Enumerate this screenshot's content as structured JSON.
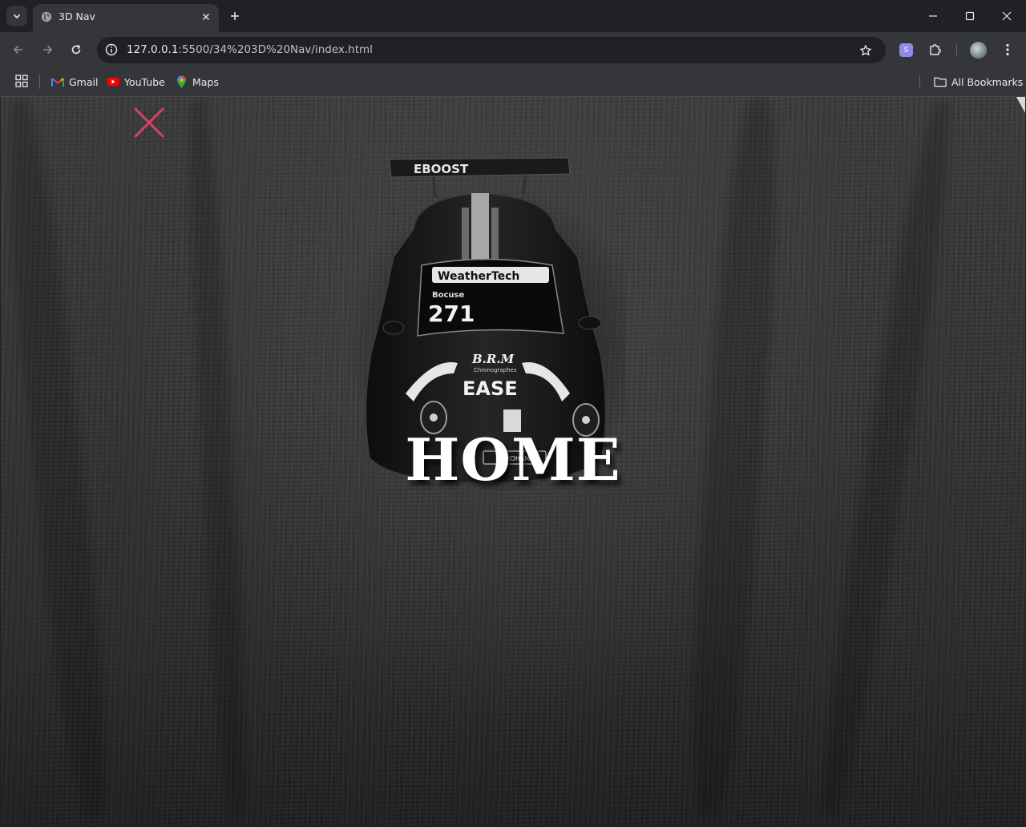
{
  "browser": {
    "tab": {
      "title": "3D Nav"
    },
    "address": {
      "host": "127.0.0.1",
      "path": ":5500/34%203D%20Nav/index.html"
    },
    "bookmarks": [
      {
        "label": "Gmail",
        "icon": "gmail-icon"
      },
      {
        "label": "YouTube",
        "icon": "youtube-icon"
      },
      {
        "label": "Maps",
        "icon": "maps-icon"
      }
    ],
    "all_bookmarks_label": "All Bookmarks",
    "extension_label": "S"
  },
  "page": {
    "heading": "HOME",
    "close_icon": "close-icon",
    "accent_color": "#d6406a",
    "car_decals": {
      "wing": "EBOOST",
      "windshield": "WeatherTech",
      "driver": "Bocuse",
      "number": "271",
      "hood_brand": "B.R.M",
      "hood_sub": "Chronographes",
      "hood_main": "EASE",
      "plate": "YOKOHAMA"
    }
  }
}
